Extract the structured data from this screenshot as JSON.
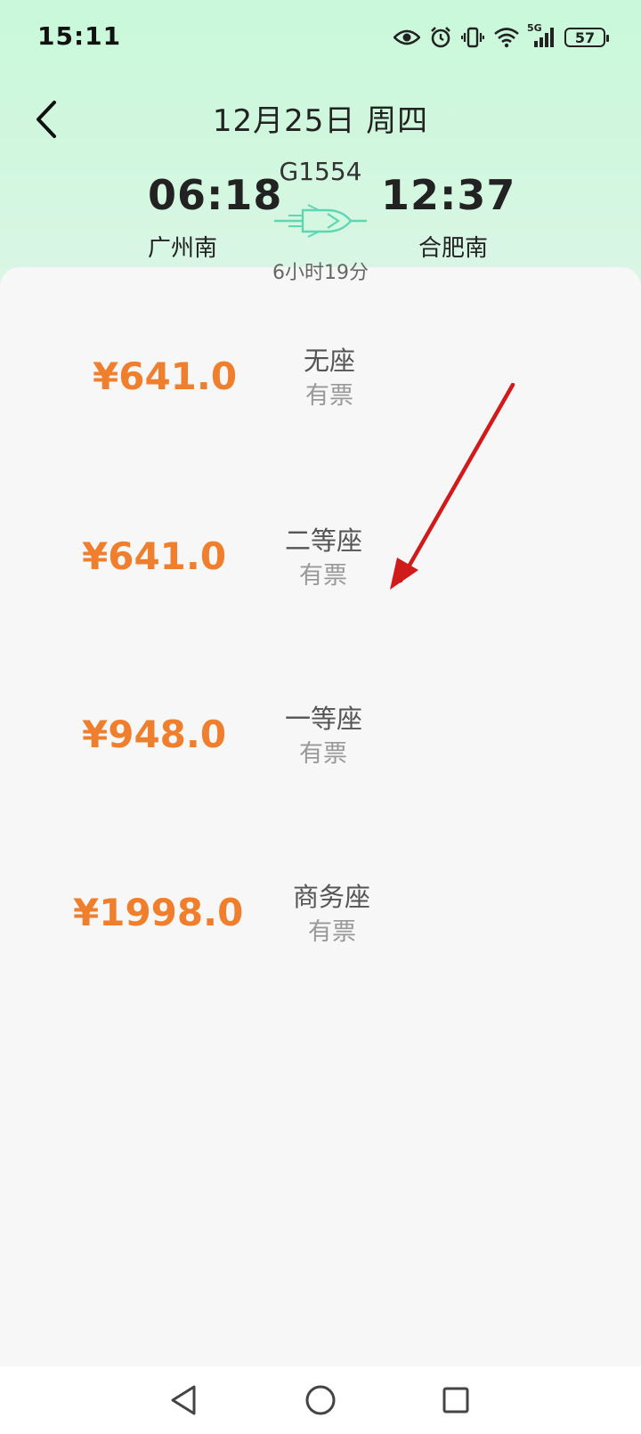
{
  "status_bar": {
    "time": "15:11",
    "battery": "57",
    "network": "5G",
    "icons": [
      "eye-icon",
      "alarm-icon",
      "vibrate-icon",
      "wifi-icon",
      "signal-icon",
      "battery-icon"
    ]
  },
  "header": {
    "date": "12月25日 周四"
  },
  "train": {
    "number": "G1554",
    "departure_time": "06:18",
    "arrival_time": "12:37",
    "departure_station": "广州南",
    "arrival_station": "合肥南",
    "duration": "6小时19分"
  },
  "seats": [
    {
      "price": "¥641.0",
      "name": "无座",
      "status": "有票"
    },
    {
      "price": "¥641.0",
      "name": "二等座",
      "status": "有票"
    },
    {
      "price": "¥948.0",
      "name": "一等座",
      "status": "有票"
    },
    {
      "price": "¥1998.0",
      "name": "商务座",
      "status": "有票"
    }
  ],
  "colors": {
    "price": "#f07f2d",
    "header_bg": "#c9f8da",
    "train_icon": "#5fd6b3",
    "annotation_arrow": "#d11a1a"
  }
}
